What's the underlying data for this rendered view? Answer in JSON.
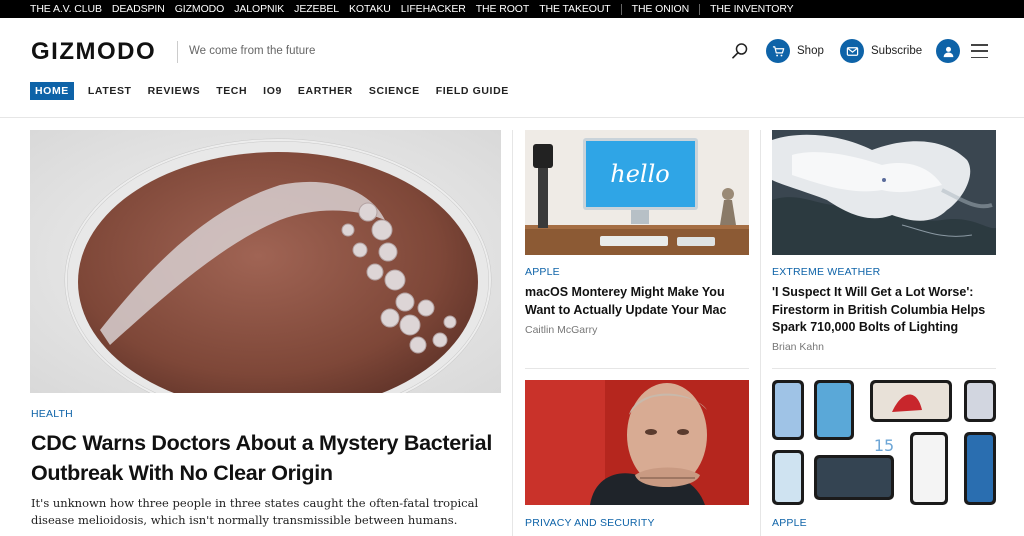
{
  "network": [
    "THE A.V. CLUB",
    "DEADSPIN",
    "GIZMODO",
    "JALOPNIK",
    "JEZEBEL",
    "KOTAKU",
    "LIFEHACKER",
    "THE ROOT",
    "THE TAKEOUT",
    "THE ONION",
    "THE INVENTORY"
  ],
  "header": {
    "logo": "GIZMODO",
    "tagline": "We come from the future",
    "shop_label": "Shop",
    "subscribe_label": "Subscribe"
  },
  "nav": [
    "HOME",
    "LATEST",
    "REVIEWS",
    "TECH",
    "IO9",
    "EARTHER",
    "SCIENCE",
    "FIELD GUIDE"
  ],
  "colors": {
    "accent": "#0e63a8",
    "network_bar": "#000000"
  },
  "featured": {
    "category": "HEALTH",
    "headline": "CDC Warns Doctors About a Mystery Bacterial Outbreak With No Clear Origin",
    "excerpt": "It's unknown how three people in three states caught the often-fatal tropical disease melioidosis, which isn't normally transmissible between humans."
  },
  "articles": [
    {
      "category": "APPLE",
      "headline": "macOS Monterey Might Make You Want to Actually Update Your Mac",
      "author": "Caitlin McGarry",
      "image_text": "hello"
    },
    {
      "category": "EXTREME WEATHER",
      "headline": "'I Suspect It Will Get a Lot Worse': Firestorm in British Columbia Helps Spark 710,000 Bolts of Lighting",
      "author": "Brian Kahn"
    },
    {
      "category": "PRIVACY AND SECURITY"
    },
    {
      "category": "APPLE",
      "image_text": "15"
    }
  ]
}
